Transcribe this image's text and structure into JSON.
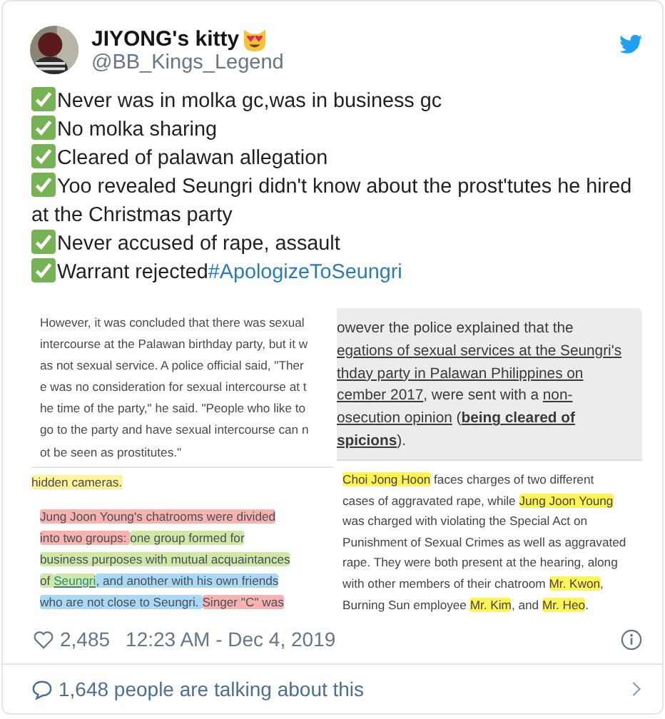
{
  "author": {
    "name": "JIYONG's kitty",
    "handle": "@BB_Kings_Legend"
  },
  "tweet_lines": [
    {
      "text": "Never was in molka gc,was in business gc"
    },
    {
      "text": "No molka sharing"
    },
    {
      "text": "Cleared of palawan allegation"
    },
    {
      "text": "Yoo revealed Seungri didn't know about the prost'tutes he hired at the Christmas party"
    },
    {
      "text": "Never accused of rape, assault"
    },
    {
      "text": "Warrant rejected",
      "hashtag": "#ApologizeToSeungri"
    }
  ],
  "images": {
    "left": {
      "clipping_1": [
        "However, it was concluded that there was sexual",
        "intercourse at the Palawan birthday party, but it w",
        "as not sexual service. A police official said, \"Ther",
        "e was no consideration for sexual intercourse at t",
        "he time of the party,\" he said. \"People who like to",
        "go to the party and have sexual intercourse can n",
        "ot be seen as prostitutes.\""
      ],
      "clipping_2": [
        [
          {
            "kind": "highlight",
            "color": "#fff3a0",
            "text": "hidden cameras."
          }
        ]
      ],
      "clipping_3": [
        [
          {
            "kind": "highlight",
            "color": "#f6b3b0",
            "text": "Jung Joon Young's chatrooms were divided"
          }
        ],
        [
          {
            "kind": "highlight",
            "color": "#f6b3b0",
            "text": "into two groups: "
          },
          {
            "kind": "highlight",
            "color": "#cfe8a8",
            "text": "one group formed for"
          }
        ],
        [
          {
            "kind": "highlight",
            "color": "#cfe8a8",
            "text": "business purposes with mutual acquaintances"
          }
        ],
        [
          {
            "kind": "highlight",
            "color": "#cfe8a8",
            "text": "of "
          },
          {
            "kind": "link",
            "color": "#cfe8a8",
            "text": "Seungri"
          },
          {
            "kind": "highlight",
            "color": "#aad8f5",
            "text": ", and another with his own friends"
          }
        ],
        [
          {
            "kind": "highlight",
            "color": "#aad8f5",
            "text": "who are not close to Seungri. "
          },
          {
            "kind": "highlight",
            "color": "#f6b3b0",
            "text": "Singer \"C\" was"
          }
        ]
      ]
    },
    "right": {
      "clipping_1": [
        [
          {
            "kind": "plain",
            "text": "owever the police explained that the"
          }
        ],
        [
          {
            "kind": "underline",
            "text": "egations of sexual services at the Seungri's"
          }
        ],
        [
          {
            "kind": "underline",
            "text": "thday party in Palawan Philippines on"
          }
        ],
        [
          {
            "kind": "underline",
            "text": "cember 2017"
          },
          {
            "kind": "plain",
            "text": ", were sent with a "
          },
          {
            "kind": "underline",
            "text": "non-"
          }
        ],
        [
          {
            "kind": "underline",
            "text": "osecution opinion"
          },
          {
            "kind": "plain",
            "text": " ("
          },
          {
            "kind": "strong",
            "text": "being cleared of"
          }
        ],
        [
          {
            "kind": "strong",
            "text": "spicions"
          },
          {
            "kind": "plain",
            "text": ")."
          }
        ]
      ],
      "clipping_2": [
        [
          {
            "kind": "highlight",
            "color": "#fff35a",
            "text": "Choi Jong Hoon"
          },
          {
            "kind": "plain",
            "text": " faces charges of two different"
          }
        ],
        [
          {
            "kind": "plain",
            "text": "cases of aggravated rape, while "
          },
          {
            "kind": "highlight",
            "color": "#fff35a",
            "text": "Jung Joon Young"
          }
        ],
        [
          {
            "kind": "plain",
            "text": "was charged with violating the Special Act on"
          }
        ],
        [
          {
            "kind": "plain",
            "text": "Punishment of Sexual Crimes as well as aggravated"
          }
        ],
        [
          {
            "kind": "plain",
            "text": "rape. They were both present at the hearing, along"
          }
        ],
        [
          {
            "kind": "plain",
            "text": "with other members of their chatroom "
          },
          {
            "kind": "highlight",
            "color": "#fff35a",
            "text": "Mr. Kwon"
          },
          {
            "kind": "plain",
            "text": ","
          }
        ],
        [
          {
            "kind": "plain",
            "text": "Burning Sun employee "
          },
          {
            "kind": "highlight",
            "color": "#fff35a",
            "text": "Mr. Kim"
          },
          {
            "kind": "plain",
            "text": ", and "
          },
          {
            "kind": "highlight",
            "color": "#fff35a",
            "text": "Mr. Heo"
          },
          {
            "kind": "plain",
            "text": "."
          }
        ]
      ]
    }
  },
  "likes": "2,485",
  "timestamp": "12:23 AM - Dec 4, 2019",
  "conversation": "1,648 people are talking about this"
}
